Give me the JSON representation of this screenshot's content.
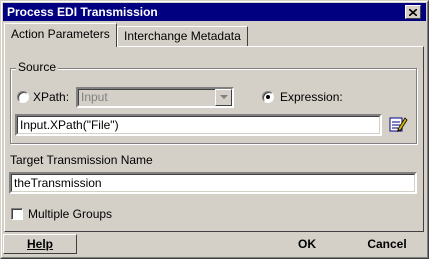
{
  "window": {
    "title": "Process EDI Transmission"
  },
  "tabs": [
    {
      "label": "Action Parameters"
    },
    {
      "label": "Interchange Metadata"
    }
  ],
  "source": {
    "group_label": "Source",
    "xpath_label": "XPath:",
    "xpath_value": "Input",
    "expression_label": "Expression:",
    "selected": "expression",
    "expression_value": "Input.XPath(\"File\")"
  },
  "target": {
    "label": "Target Transmission Name",
    "value": "theTransmission"
  },
  "multiple_groups": {
    "label": "Multiple Groups",
    "checked": false
  },
  "buttons": {
    "help": "Help",
    "ok": "OK",
    "cancel": "Cancel"
  }
}
